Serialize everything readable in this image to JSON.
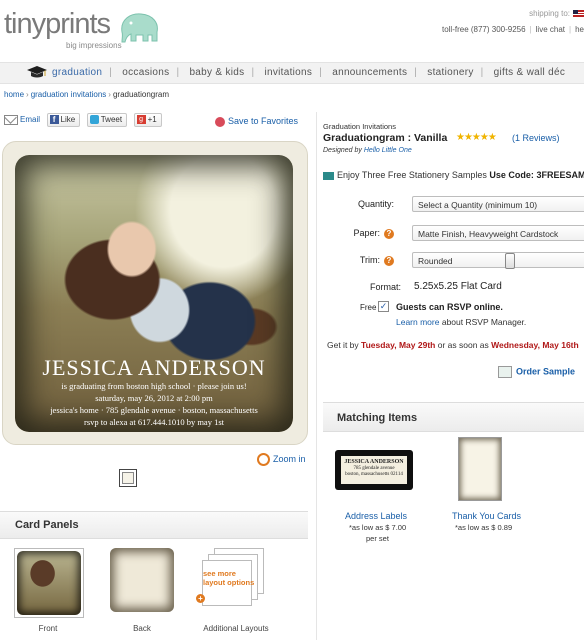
{
  "header": {
    "logo_text": "tinyprints",
    "tagline": "big impressions",
    "shipping_label": "shipping to:",
    "phone": "toll-free (877) 300-9256",
    "live_chat": "live chat",
    "help": "he"
  },
  "nav": {
    "items": [
      "graduation",
      "occasions",
      "baby & kids",
      "invitations",
      "announcements",
      "stationery",
      "gifts & wall déc"
    ],
    "active": "graduation"
  },
  "breadcrumb": [
    "home",
    "graduation invitations",
    "graduationgram"
  ],
  "share": {
    "email": "Email",
    "like": "Like",
    "tweet": "Tweet",
    "plus_one": "+1",
    "favorites": "Save to Favorites"
  },
  "card": {
    "name": "JESSICA ANDERSON",
    "line1": "is graduating from boston high school · please join us!",
    "line2": "saturday, may 26, 2012 at 2:00 pm",
    "line3": "jessica's home · 785 glendale avenue · boston, massachusetts",
    "line4": "rsvp to alexa at 617.444.1010 by may 1st"
  },
  "zoom_label": "Zoom in",
  "card_panels": {
    "title": "Card Panels",
    "front": "Front",
    "back": "Back",
    "more": "Additional Layouts",
    "more_link": "see more layout options"
  },
  "product": {
    "category": "Graduation Invitations",
    "title": "Graduationgram : Vanilla",
    "stars": "★★★★★",
    "rating": 5,
    "reviews": "(1 Reviews)",
    "designed_by_label": "Designed by",
    "designer": "Hello Little One",
    "samples_text": "Enjoy Three Free Stationery Samples",
    "samples_code_label": "Use Code:",
    "samples_code": "3FREESAM"
  },
  "options": {
    "quantity_label": "Quantity:",
    "quantity_value": "Select a Quantity (minimum 10)",
    "paper_label": "Paper:",
    "paper_value": "Matte Finish, Heavyweight Cardstock",
    "trim_label": "Trim:",
    "trim_value": "Rounded",
    "format_label": "Format:",
    "format_value": "5.25x5.25 Flat Card",
    "free_label": "Free",
    "rsvp": "Guests can RSVP online.",
    "learn_more": "Learn more",
    "learn_more_suffix": "about RSVP Manager."
  },
  "delivery": {
    "prefix": "Get it by",
    "date1": "Tuesday, May 29th",
    "middle": "or as soon as",
    "date2": "Wednesday, May 16th"
  },
  "order_sample": "Order Sample",
  "matching": {
    "title": "Matching Items",
    "items": [
      {
        "name": "Address Labels",
        "price": "*as low as $ 7.00",
        "unit": "per set",
        "label_name": "JESSICA ANDERSON",
        "label_line1": "785 glendale avenue",
        "label_line2": "boston, massachusetts 02114"
      },
      {
        "name": "Thank You Cards",
        "price": "*as low as $ 0.89"
      }
    ]
  },
  "colors": {
    "accent_orange": "#e07a20",
    "link_blue": "#1a5fa8",
    "date_red": "#b01818",
    "star_gold": "#f0b400"
  }
}
